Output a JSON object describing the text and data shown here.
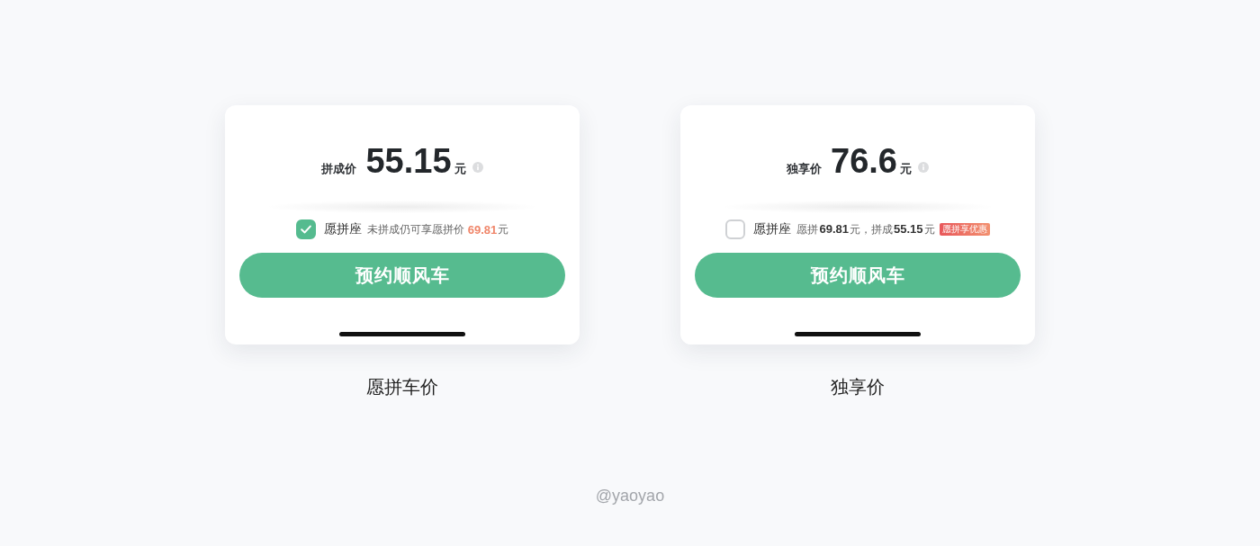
{
  "panels": [
    {
      "price_label": "拼成价",
      "price": "55.15",
      "currency": "元",
      "option": {
        "checked": true,
        "label": "愿拼座",
        "note": "未拼成仍可享愿拼价",
        "highlight_price": "69.81",
        "highlight_unit": "元"
      },
      "button": "预约顺风车",
      "caption": "愿拼车价"
    },
    {
      "price_label": "独享价",
      "price": "76.6",
      "currency": "元",
      "option": {
        "checked": false,
        "label": "愿拼座",
        "note": "愿拼**69.81**元，拼成**55.15**元",
        "badge": "愿拼享优惠"
      },
      "button": "预约顺风车",
      "caption": "独享价"
    }
  ],
  "footer": "@yaoyao"
}
